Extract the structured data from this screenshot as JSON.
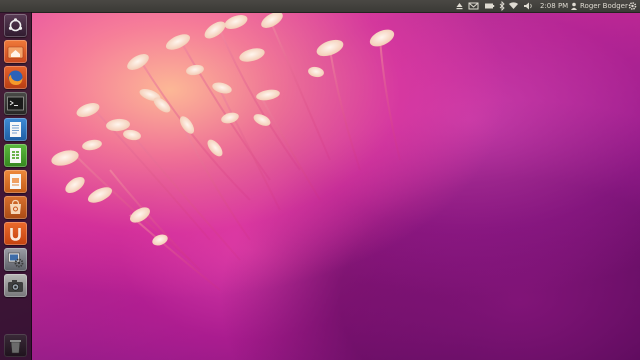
{
  "top_panel": {
    "clock": "2:08 PM",
    "user_name": "Roger Bodger"
  },
  "icons": {
    "panel": [
      "eject-icon",
      "mail-icon",
      "battery-icon",
      "bluetooth-icon",
      "wifi-icon",
      "volume-icon",
      "user-icon",
      "gear-icon"
    ],
    "launcher": [
      "ubuntu-logo-icon",
      "home-folder-icon",
      "firefox-icon",
      "terminal-icon",
      "writer-icon",
      "calc-icon",
      "impress-icon",
      "ubuntu-software-icon",
      "ubuntu-one-icon",
      "system-settings-icon",
      "camera-icon",
      "trash-icon"
    ]
  },
  "colors": {
    "panel": "#3b3a36",
    "launcher": "#28122a",
    "accent_orange": "#e65a2a",
    "text": "#dfdbd2"
  }
}
